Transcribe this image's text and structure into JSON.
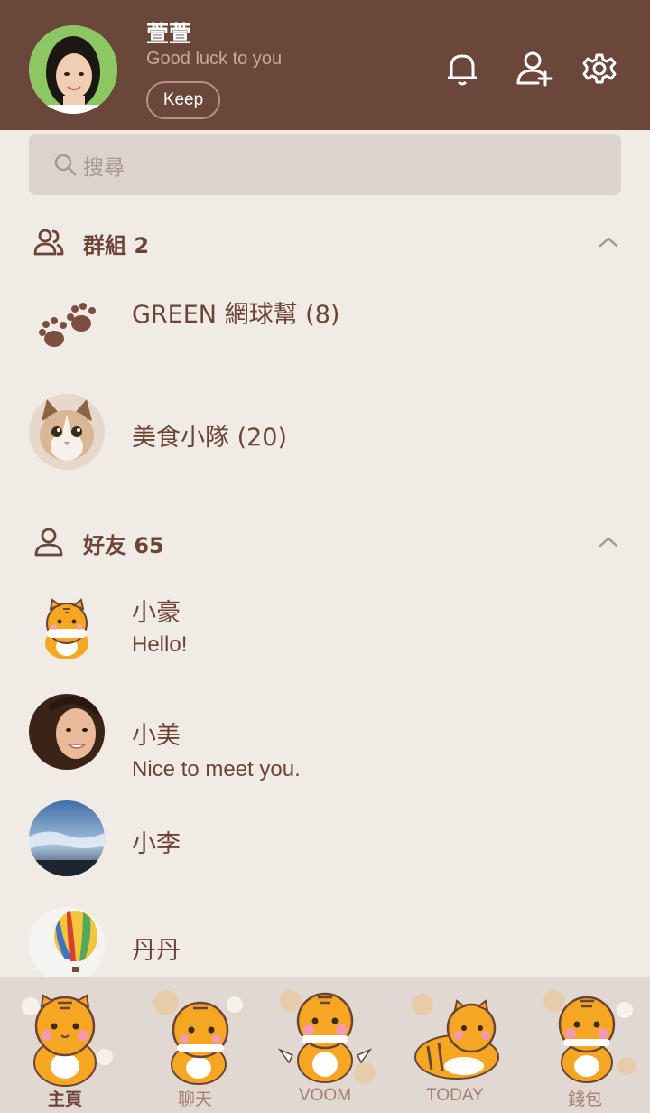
{
  "profile": {
    "name": "萱萱",
    "status": "Good luck to you",
    "keep_label": "Keep"
  },
  "search": {
    "placeholder": "搜尋"
  },
  "groups": {
    "title": "群組 2",
    "items": [
      {
        "name": "GREEN 網球幫 (8)"
      },
      {
        "name": "美食小隊 (20)"
      }
    ]
  },
  "friends": {
    "title": "好友 65",
    "items": [
      {
        "name": "小豪",
        "message": "Hello!"
      },
      {
        "name": "小美",
        "message": "Nice to meet you."
      },
      {
        "name": "小李",
        "message": ""
      },
      {
        "name": "丹丹",
        "message": ""
      }
    ]
  },
  "nav": {
    "items": [
      {
        "label": "主頁",
        "active": true
      },
      {
        "label": "聊天",
        "active": false
      },
      {
        "label": "VOOM",
        "active": false
      },
      {
        "label": "TODAY",
        "active": false
      },
      {
        "label": "錢包",
        "active": false
      }
    ]
  },
  "colors": {
    "header_bg": "#6b473b",
    "body_bg": "#f1ebe6",
    "text_brown": "#6b4436",
    "tiger_orange": "#f5a623"
  }
}
